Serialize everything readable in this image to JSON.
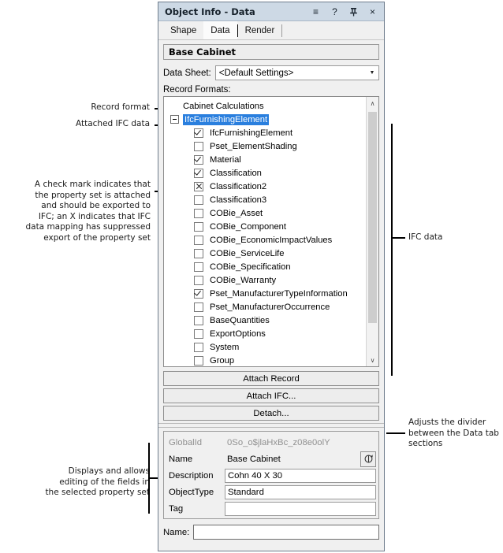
{
  "window": {
    "title": "Object Info - Data",
    "titlebar_icons": [
      {
        "name": "menu-icon",
        "glyph": "≡"
      },
      {
        "name": "help-icon",
        "glyph": "?"
      },
      {
        "name": "pin-icon",
        "glyph": "⥠"
      },
      {
        "name": "close-icon",
        "glyph": "×"
      }
    ]
  },
  "tabs": [
    {
      "label": "Shape",
      "active": false
    },
    {
      "label": "Data",
      "active": true
    },
    {
      "label": "Render",
      "active": false
    }
  ],
  "object": {
    "name_bar": "Base Cabinet"
  },
  "data_sheet": {
    "label": "Data Sheet:",
    "value": "<Default Settings>",
    "arrow": "▼"
  },
  "record_formats": {
    "label": "Record Formats:",
    "tree": [
      {
        "label": "Cabinet Calculations",
        "type": "record",
        "indent": 1,
        "selected": false
      },
      {
        "label": "IfcFurnishingElement",
        "type": "group",
        "indent": 0,
        "selected": true,
        "expander": "−"
      },
      {
        "label": "IfcFurnishingElement",
        "type": "checkbox",
        "indent": 2,
        "state": "checked"
      },
      {
        "label": "Pset_ElementShading",
        "type": "checkbox",
        "indent": 2,
        "state": "unchecked"
      },
      {
        "label": "Material",
        "type": "checkbox",
        "indent": 2,
        "state": "checked"
      },
      {
        "label": "Classification",
        "type": "checkbox",
        "indent": 2,
        "state": "checked"
      },
      {
        "label": "Classification2",
        "type": "checkbox",
        "indent": 2,
        "state": "cross"
      },
      {
        "label": "Classification3",
        "type": "checkbox",
        "indent": 2,
        "state": "unchecked"
      },
      {
        "label": "COBie_Asset",
        "type": "checkbox",
        "indent": 2,
        "state": "unchecked"
      },
      {
        "label": "COBie_Component",
        "type": "checkbox",
        "indent": 2,
        "state": "unchecked"
      },
      {
        "label": "COBie_EconomicImpactValues",
        "type": "checkbox",
        "indent": 2,
        "state": "unchecked"
      },
      {
        "label": "COBie_ServiceLife",
        "type": "checkbox",
        "indent": 2,
        "state": "unchecked"
      },
      {
        "label": "COBie_Specification",
        "type": "checkbox",
        "indent": 2,
        "state": "unchecked"
      },
      {
        "label": "COBie_Warranty",
        "type": "checkbox",
        "indent": 2,
        "state": "unchecked"
      },
      {
        "label": "Pset_ManufacturerTypeInformation",
        "type": "checkbox",
        "indent": 2,
        "state": "checked"
      },
      {
        "label": "Pset_ManufacturerOccurrence",
        "type": "checkbox",
        "indent": 2,
        "state": "unchecked"
      },
      {
        "label": "BaseQuantities",
        "type": "checkbox",
        "indent": 2,
        "state": "unchecked"
      },
      {
        "label": "ExportOptions",
        "type": "checkbox",
        "indent": 2,
        "state": "unchecked"
      },
      {
        "label": "System",
        "type": "checkbox",
        "indent": 2,
        "state": "unchecked"
      },
      {
        "label": "Group",
        "type": "checkbox",
        "indent": 2,
        "state": "unchecked"
      }
    ],
    "scroll_up": "∧",
    "scroll_down": "∨"
  },
  "buttons": [
    {
      "label": "Attach Record",
      "name": "attach-record-button"
    },
    {
      "label": "Attach IFC...",
      "name": "attach-ifc-button"
    },
    {
      "label": "Detach...",
      "name": "detach-button"
    }
  ],
  "property_grid": {
    "rows": [
      {
        "name": "GlobalId",
        "value": "0So_o$jlaHxBc_z08e0olY",
        "editable": false,
        "dim": true
      },
      {
        "name": "Name",
        "value": "Base Cabinet",
        "editable": false,
        "dim": false,
        "picker": true
      },
      {
        "name": "Description",
        "value": "Cohn 40 X 30",
        "editable": true,
        "dim": false
      },
      {
        "name": "ObjectType",
        "value": "Standard",
        "editable": true,
        "dim": false
      },
      {
        "name": "Tag",
        "value": "",
        "editable": true,
        "dim": false
      }
    ]
  },
  "bottom_name": {
    "label": "Name:",
    "value": "",
    "placeholder": ""
  },
  "annotations": {
    "record_format": "Record format",
    "attached_ifc_data": "Attached IFC data",
    "check_mark_note": "A check mark indicates that\nthe property set is attached\nand should be exported to\nIFC; an X indicates that IFC\ndata mapping has suppressed\nexport of the property set",
    "ifc_data": "IFC data",
    "adjusts_divider": "Adjusts the divider\nbetween the Data tab\nsections",
    "displays_allows": "Displays and allows\nediting of the fields in\nthe selected property set"
  },
  "colors": {
    "titlebar": "#cdd9e5",
    "selection": "#2a7fde",
    "panel": "#f0f0f0"
  }
}
